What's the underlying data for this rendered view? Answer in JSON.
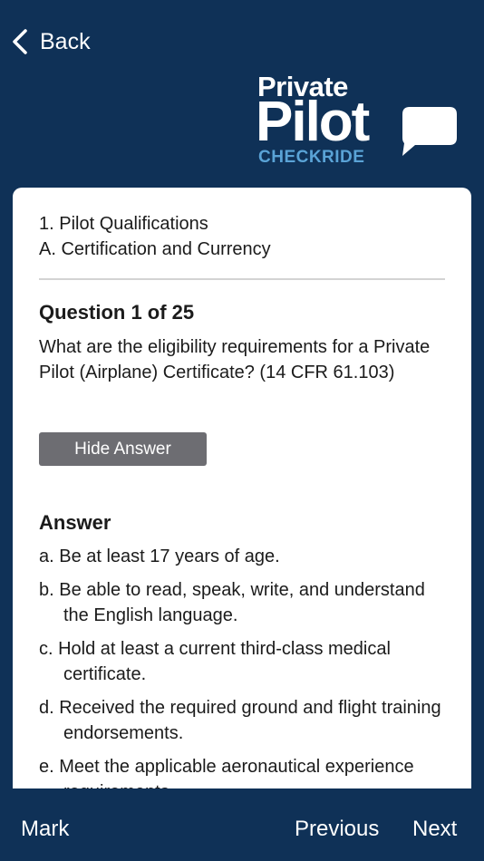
{
  "header": {
    "back_label": "Back",
    "logo": {
      "line1": "Private",
      "line2": "Pilot",
      "line3": "CHECKRIDE"
    }
  },
  "card": {
    "section": "1. Pilot Qualifications",
    "category": "A. Certification and Currency",
    "question_number": "Question 1 of 25",
    "question_text": "What are the eligibility requirements for a Private Pilot (Airplane) Certificate? (14 CFR 61.103)",
    "hide_answer_label": "Hide Answer",
    "answer_title": "Answer",
    "answers": [
      "a. Be at least 17 years of age.",
      "b. Be able to read, speak, write, and understand the English language.",
      "c. Hold at least a current third-class medical certificate.",
      "d. Received the required ground and flight training endorsements.",
      "e. Meet the applicable aeronautical experience requirements."
    ]
  },
  "footer": {
    "mark_label": "Mark",
    "previous_label": "Previous",
    "next_label": "Next"
  },
  "colors": {
    "background": "#0f3157",
    "card": "#ffffff",
    "accent": "#5aa3d6",
    "button_gray": "#6d6d72"
  }
}
